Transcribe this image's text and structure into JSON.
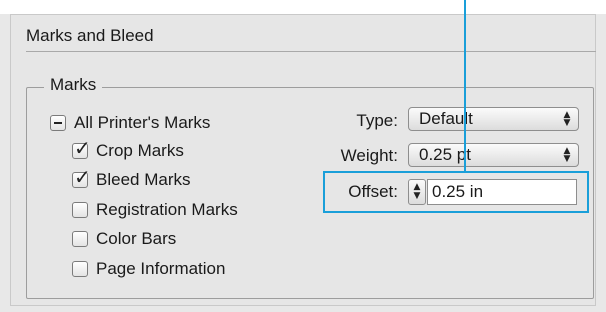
{
  "section": {
    "title": "Marks and Bleed"
  },
  "marks": {
    "group_label": "Marks",
    "all_printers_marks": {
      "label": "All Printer's Marks",
      "state": "mixed"
    },
    "items": [
      {
        "label": "Crop Marks",
        "checked": true
      },
      {
        "label": "Bleed Marks",
        "checked": true
      },
      {
        "label": "Registration Marks",
        "checked": false
      },
      {
        "label": "Color Bars",
        "checked": false
      },
      {
        "label": "Page Information",
        "checked": false
      }
    ],
    "type": {
      "label": "Type:",
      "value": "Default"
    },
    "weight": {
      "label": "Weight:",
      "value": "0.25 pt"
    },
    "offset": {
      "label": "Offset:",
      "value": "0.25 in"
    }
  },
  "colors": {
    "highlight": "#1a9fd9"
  }
}
